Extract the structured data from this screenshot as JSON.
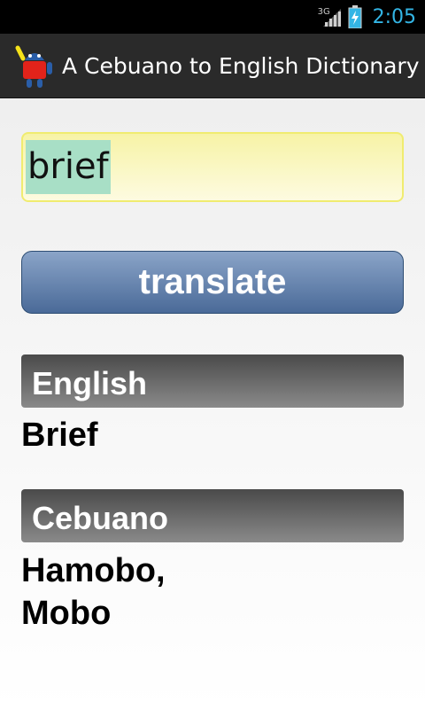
{
  "status_bar": {
    "network": "3G",
    "time": "2:05",
    "signal_icon": "signal-icon",
    "battery_icon": "battery-charging-icon",
    "clock_color": "#33b5e5"
  },
  "action_bar": {
    "title": "A Cebuano to English Dictionary",
    "logo_icon": "android-robot-icon"
  },
  "search": {
    "value": "brief"
  },
  "translate_button": {
    "label": "translate"
  },
  "english_section": {
    "header": "English",
    "result": "Brief"
  },
  "cebuano_section": {
    "header": "Cebuano",
    "result_lines": [
      "Hamobo,",
      "Mobo"
    ]
  }
}
